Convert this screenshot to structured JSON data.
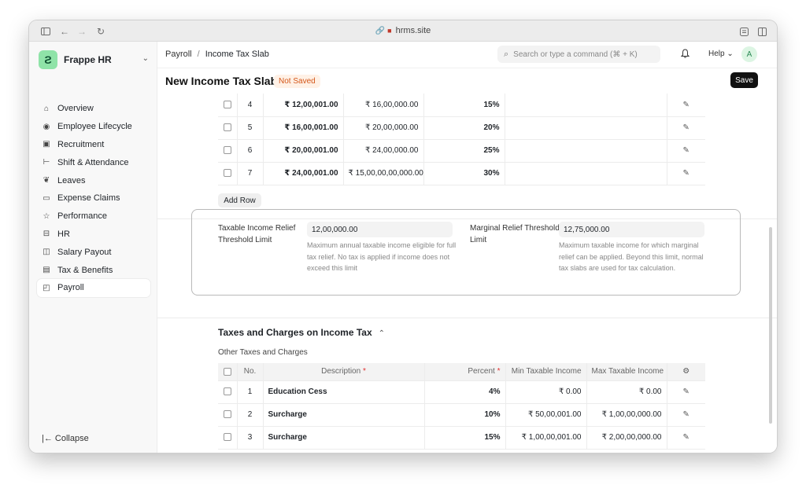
{
  "browser": {
    "url": "hrms.site"
  },
  "sidebar": {
    "app_name": "Frappe HR",
    "items": [
      {
        "label": "Overview",
        "icon": "house-icon"
      },
      {
        "label": "Employee Lifecycle",
        "icon": "user-circle-icon"
      },
      {
        "label": "Recruitment",
        "icon": "briefcase-icon"
      },
      {
        "label": "Shift & Attendance",
        "icon": "signpost-icon"
      },
      {
        "label": "Leaves",
        "icon": "leaf-icon"
      },
      {
        "label": "Expense Claims",
        "icon": "receipt-icon"
      },
      {
        "label": "Performance",
        "icon": "star-icon"
      },
      {
        "label": "HR",
        "icon": "building-icon"
      },
      {
        "label": "Salary Payout",
        "icon": "wallet-icon"
      },
      {
        "label": "Tax & Benefits",
        "icon": "document-icon"
      },
      {
        "label": "Payroll",
        "icon": "payroll-icon",
        "active": true
      }
    ],
    "collapse_label": "Collapse"
  },
  "topbar": {
    "breadcrumb": [
      "Payroll",
      "Income Tax Slab"
    ],
    "search_placeholder": "Search or type a command (⌘ + K)",
    "help_label": "Help",
    "avatar_initial": "A"
  },
  "page": {
    "title": "New Income Tax Slab",
    "status_badge": "Not Saved",
    "save_label": "Save"
  },
  "slabs_table": {
    "rows": [
      {
        "no": "4",
        "from": "₹ 12,00,001.00",
        "to": "₹ 16,00,000.00",
        "percent": "15%"
      },
      {
        "no": "5",
        "from": "₹ 16,00,001.00",
        "to": "₹ 20,00,000.00",
        "percent": "20%"
      },
      {
        "no": "6",
        "from": "₹ 20,00,001.00",
        "to": "₹ 24,00,000.00",
        "percent": "25%"
      },
      {
        "no": "7",
        "from": "₹ 24,00,001.00",
        "to": "₹ 15,00,00,00,000.00",
        "percent": "30%"
      }
    ],
    "add_row_label": "Add Row"
  },
  "relief": {
    "taxable_label": "Taxable Income Relief Threshold Limit",
    "taxable_value": "12,00,000.00",
    "taxable_desc": "Maximum annual taxable income eligible for full tax relief. No tax is applied if income does not exceed this limit",
    "marginal_label": "Marginal Relief Threshold Limit",
    "marginal_value": "12,75,000.00",
    "marginal_desc": "Maximum taxable income for which marginal relief can be applied. Beyond this limit, normal tax slabs are used for tax calculation."
  },
  "taxes_section": {
    "title": "Taxes and Charges on Income Tax",
    "subtitle": "Other Taxes and Charges",
    "columns": {
      "no": "No.",
      "description": "Description",
      "percent": "Percent",
      "min": "Min Taxable Income",
      "max": "Max Taxable Income"
    },
    "rows": [
      {
        "no": "1",
        "description": "Education Cess",
        "percent": "4%",
        "min": "₹ 0.00",
        "max": "₹ 0.00"
      },
      {
        "no": "2",
        "description": "Surcharge",
        "percent": "10%",
        "min": "₹ 50,00,001.00",
        "max": "₹ 1,00,00,000.00"
      },
      {
        "no": "3",
        "description": "Surcharge",
        "percent": "15%",
        "min": "₹ 1,00,00,001.00",
        "max": "₹ 2,00,00,000.00"
      }
    ]
  }
}
